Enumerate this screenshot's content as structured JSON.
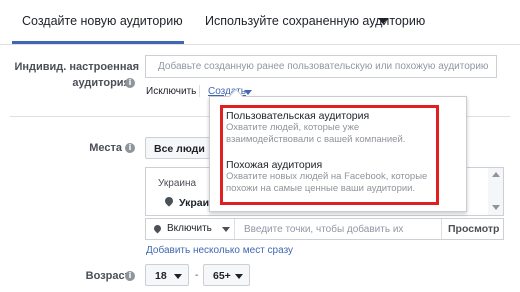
{
  "tabs": {
    "create_new": "Создайте новую аудиторию",
    "use_saved": "Используйте сохраненную аудиторию"
  },
  "custom_audience": {
    "label_line1": "Индивид. настроенная",
    "label_line2": "аудитория",
    "placeholder": "Добавьте созданную ранее пользовательскую или похожую аудиторию",
    "exclude_link": "Исключить",
    "create_link": "Создать"
  },
  "create_menu": {
    "options": [
      {
        "title": "Пользовательская аудитория",
        "description": "Охватите людей, которые уже взаимодействовали с вашей компанией."
      },
      {
        "title": "Похожая аудитория",
        "description": "Охватите новых людей на Facebook, которые похожи на самые ценные ваши аудитории."
      }
    ]
  },
  "locations": {
    "label": "Места",
    "audience_select": "Все люди",
    "country": "Украина",
    "selected_item": "Украина",
    "include_select": "Включить",
    "search_placeholder": "Введите точки, чтобы добавить их",
    "browse_button": "Просмотр",
    "add_multiple_link": "Добавить несколько мест сразу"
  },
  "age": {
    "label": "Возраст",
    "min": "18",
    "separator": "-",
    "max": "65+"
  },
  "colors": {
    "accent": "#4267b2",
    "highlight_border": "#e02020"
  }
}
